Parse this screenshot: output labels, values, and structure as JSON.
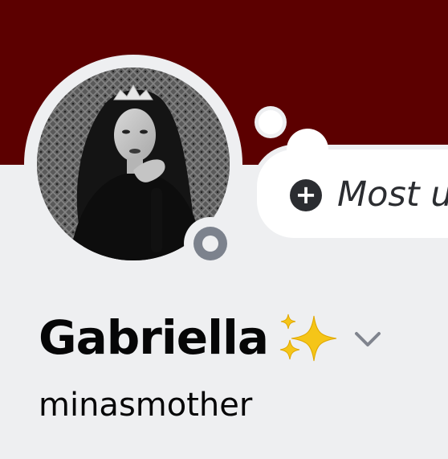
{
  "profile": {
    "display_name": "Gabriella",
    "username": "minasmother",
    "custom_status": "Most u",
    "status": "offline"
  },
  "icons": {
    "add_status": "plus-circle-icon",
    "name_decoration": "sparkles-icon",
    "expand": "chevron-down-icon",
    "presence": "offline-status-icon"
  },
  "colors": {
    "banner": "#5c0000",
    "background": "#eeeff1",
    "status_offline": "#7c828d",
    "sparkle": "#f5c518"
  }
}
